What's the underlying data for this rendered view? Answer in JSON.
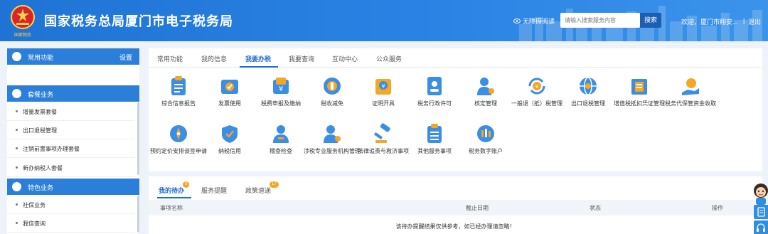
{
  "header": {
    "emblem_caption": "国家税务",
    "title": "国家税务总局厦门市电子税务局",
    "accessible_reading": "无障碍阅读",
    "search_placeholder": "请输入搜索服务内容",
    "search_button": "搜索",
    "welcome": "欢迎，厦门市翔安...",
    "divider": "|",
    "logout": "退出"
  },
  "sidebar": {
    "common": {
      "label": "常用功能",
      "settings": "设置"
    },
    "tax_service": {
      "label": "套餐业务",
      "items": [
        "增量发票套餐",
        "出口退税管理",
        "注销前置事项办理套餐",
        "新办纳税人套餐"
      ]
    },
    "special": {
      "label": "特色业务",
      "items": [
        "社保业务",
        "我信查询"
      ]
    }
  },
  "tabs": [
    "常用功能",
    "我的信息",
    "我要办税",
    "我要查询",
    "互动中心",
    "公众服务"
  ],
  "active_tab": "我要办税",
  "tiles": [
    "综合信息报告",
    "发票使用",
    "税费申报及缴纳",
    "税收减免",
    "证明开具",
    "税务行政许可",
    "核定管理",
    "一般退（抵）税管理",
    "出口退税管理",
    "增值税抵扣凭证管理",
    "税务代保管资金收取",
    "预约定价安排谈签申请",
    "纳税信用",
    "稽查检查",
    "涉税专业服务机构管理",
    "法律追责与救济事项",
    "其他服务事项",
    "税务数字账户"
  ],
  "bottom_tabs": [
    {
      "label": "我的待办",
      "badge": "0"
    },
    {
      "label": "服务提醒",
      "badge": ""
    },
    {
      "label": "政策速递",
      "badge": "17"
    }
  ],
  "table": {
    "headers": [
      "事项名称",
      "截止日期",
      "状态",
      "操作"
    ],
    "empty_message": "该待办提醒结果仅供参考，如已经办理请忽略！"
  },
  "colors": {
    "primary": "#1f6fd0",
    "header": "#2a83e4",
    "badge": "#f5a623",
    "icon_blue": "#3a8ee6",
    "icon_orange": "#f5a623"
  }
}
